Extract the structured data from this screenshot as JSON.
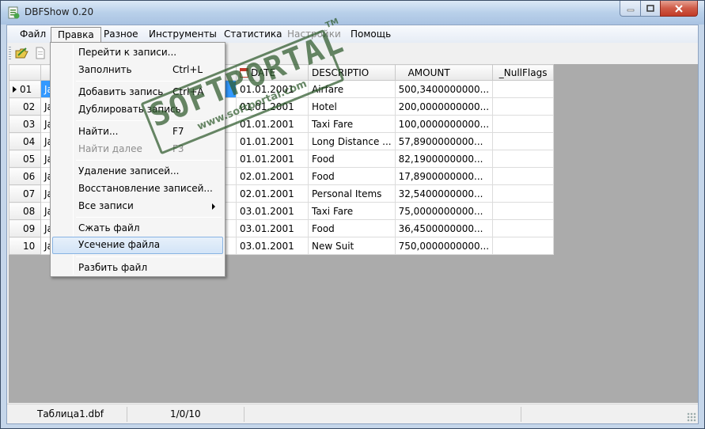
{
  "window": {
    "title": "DBFShow 0.20",
    "icon": "dbf-app-icon"
  },
  "menubar": {
    "items": [
      "Файл",
      "Правка",
      "Разное",
      "Инструменты",
      "Статистика",
      "Настройки",
      "Помощь"
    ]
  },
  "toolbar": {
    "icons": [
      "open-folder-icon",
      "new-file-icon"
    ]
  },
  "grid": {
    "columns": [
      "",
      "",
      "DATE",
      "DESCRIPTIO",
      "AMOUNT",
      "_NullFlags"
    ],
    "rows": [
      {
        "num": "01",
        "name": "Ja",
        "date": "01.01.2001",
        "desc": "Airfare",
        "amount": "500,3400000000...",
        "null": ""
      },
      {
        "num": "02",
        "name": "Ja",
        "date": "01.01.2001",
        "desc": "Hotel",
        "amount": "200,0000000000...",
        "null": ""
      },
      {
        "num": "03",
        "name": "Ja",
        "date": "01.01.2001",
        "desc": "Taxi Fare",
        "amount": "100,0000000000...",
        "null": ""
      },
      {
        "num": "04",
        "name": "Ja",
        "date": "01.01.2001",
        "desc": "Long Distance ...",
        "amount": "57,8900000000...",
        "null": ""
      },
      {
        "num": "05",
        "name": "Ja",
        "date": "01.01.2001",
        "desc": "Food",
        "amount": "82,1900000000...",
        "null": ""
      },
      {
        "num": "06",
        "name": "Ja",
        "date": "02.01.2001",
        "desc": "Food",
        "amount": "17,8900000000...",
        "null": ""
      },
      {
        "num": "07",
        "name": "Ja",
        "date": "02.01.2001",
        "desc": "Personal Items",
        "amount": "32,5400000000...",
        "null": ""
      },
      {
        "num": "08",
        "name": "Ja",
        "date": "03.01.2001",
        "desc": "Taxi Fare",
        "amount": "75,0000000000...",
        "null": ""
      },
      {
        "num": "09",
        "name": "Ja",
        "date": "03.01.2001",
        "desc": "Food",
        "amount": "36,4500000000...",
        "null": ""
      },
      {
        "num": "10",
        "name": "Ja",
        "date": "03.01.2001",
        "desc": "New Suit",
        "amount": "750,0000000000...",
        "null": ""
      }
    ]
  },
  "dropdown": {
    "items": [
      {
        "label": "Перейти к записи...",
        "shortcut": ""
      },
      {
        "label": "Заполнить",
        "shortcut": "Ctrl+L"
      },
      {
        "label": "Добавить запись",
        "shortcut": "Ctrl+A"
      },
      {
        "label": "Дублировать запись",
        "shortcut": ""
      },
      {
        "label": "Найти...",
        "shortcut": "F7"
      },
      {
        "label": "Найти далее",
        "shortcut": "F3"
      },
      {
        "label": "Удаление записей...",
        "shortcut": ""
      },
      {
        "label": "Восстановление записей...",
        "shortcut": ""
      },
      {
        "label": "Все записи",
        "shortcut": ""
      },
      {
        "label": "Сжать файл",
        "shortcut": ""
      },
      {
        "label": "Усечение файла",
        "shortcut": ""
      },
      {
        "label": "Разбить файл",
        "shortcut": ""
      }
    ]
  },
  "statusbar": {
    "filename": "Таблица1.dbf",
    "position": "1/0/10"
  },
  "watermark": {
    "main": "SOFTPORTAL",
    "sub": "www.softportal.com",
    "tm": "TM"
  },
  "colors": {
    "selection": "#3399ff",
    "menu_hover": "#d3e4f7",
    "workspace": "#ababab"
  }
}
